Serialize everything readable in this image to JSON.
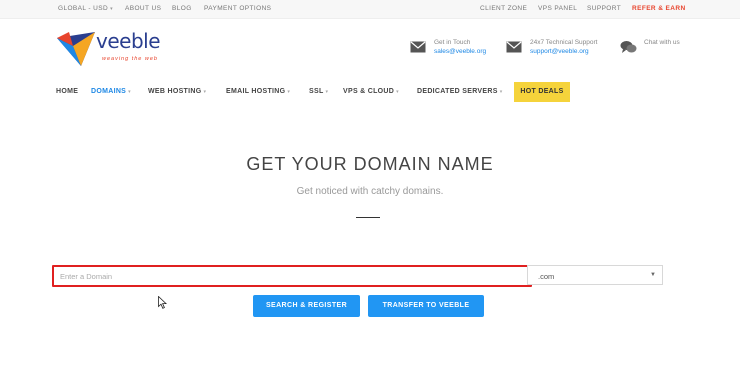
{
  "topbar": {
    "region": "GLOBAL - USD",
    "about": "ABOUT US",
    "blog": "BLOG",
    "payment": "PAYMENT OPTIONS",
    "client_zone": "CLIENT ZONE",
    "vps_panel": "VPS PANEL",
    "support": "SUPPORT",
    "refer": "REFER & EARN"
  },
  "brand": {
    "name": "veeble",
    "tagline": "weaving the web",
    "color": "#2a3e8f",
    "accent": "#e8442d"
  },
  "contacts": [
    {
      "title": "Get in Touch",
      "value": "sales@veeble.org",
      "icon": "envelope-icon"
    },
    {
      "title": "24x7 Technical Support",
      "value": "support@veeble.org",
      "icon": "envelope-icon"
    },
    {
      "title": "Chat with us",
      "value": "",
      "icon": "chat-bubbles-icon"
    }
  ],
  "nav": {
    "home": "HOME",
    "domains": "DOMAINS",
    "web_hosting": "WEB HOSTING",
    "email_hosting": "EMAIL HOSTING",
    "ssl": "SSL",
    "vps_cloud": "VPS & CLOUD",
    "dedicated": "DEDICATED SERVERS",
    "hot_deals": "HOT DEALS"
  },
  "hero": {
    "title": "GET YOUR DOMAIN NAME",
    "subtitle": "Get noticed with catchy domains."
  },
  "search": {
    "placeholder": "Enter a Domain",
    "value": "",
    "tld": ".com",
    "search_button": "SEARCH & REGISTER",
    "transfer_button": "TRANSFER TO VEEBLE"
  },
  "colors": {
    "primary": "#2196f3",
    "hot_deals_bg": "#f5d33b",
    "focus_border": "#e02020"
  }
}
